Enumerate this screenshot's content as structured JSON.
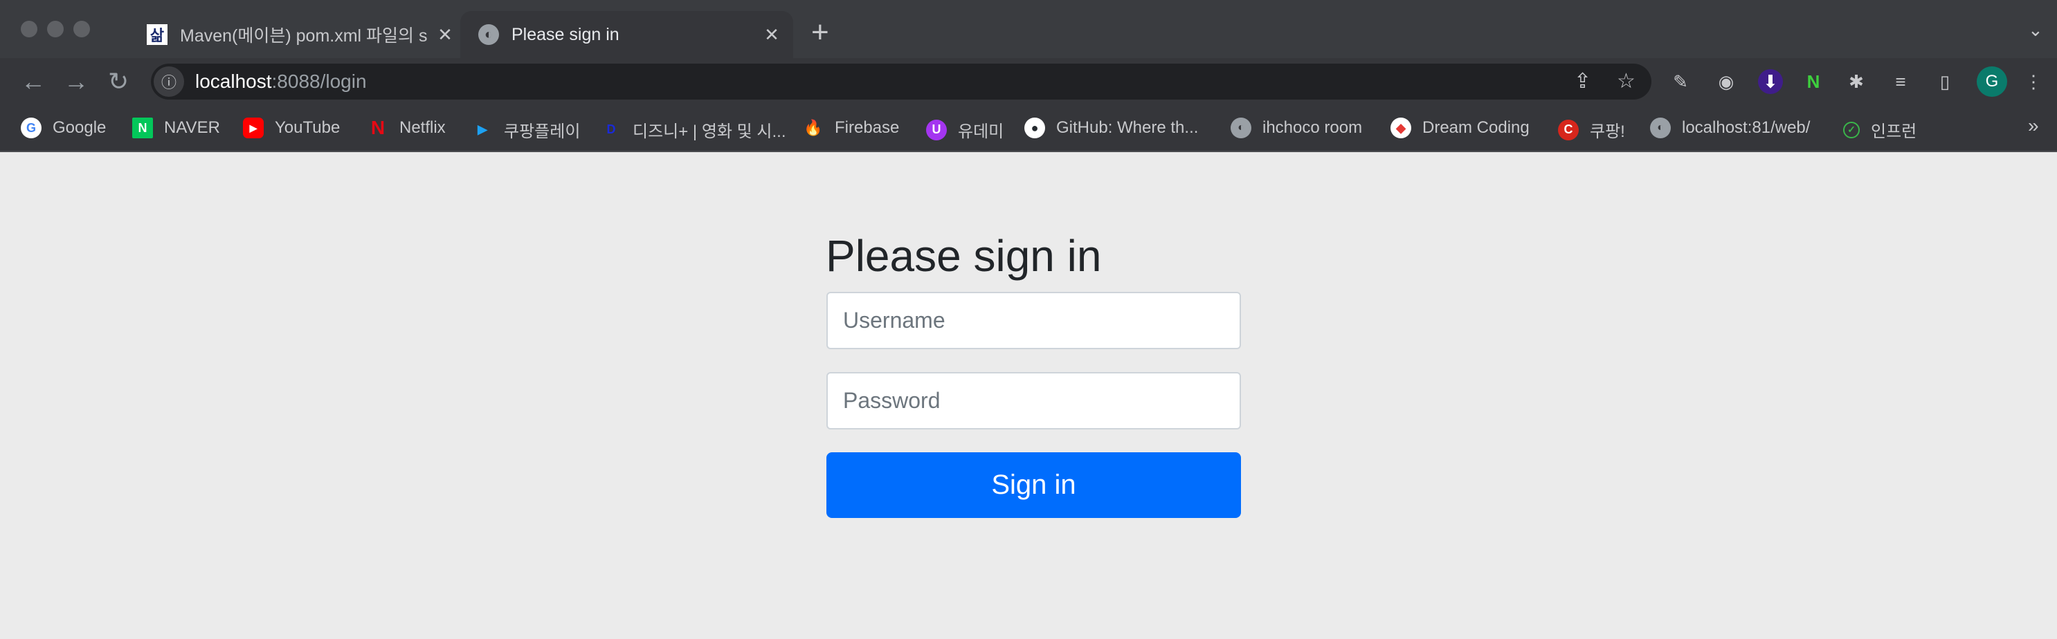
{
  "browser": {
    "tabs": [
      {
        "title": "Maven(메이븐) pom.xml 파일의 s",
        "favicon": "삶",
        "active": false
      },
      {
        "title": "Please sign in",
        "favicon": "globe-icon",
        "active": true
      }
    ],
    "new_tab": "+",
    "tab_search": "⌄",
    "url_host": "localhost",
    "url_rest": ":8088/login",
    "avatar_letter": "G",
    "bookmarks": [
      {
        "label": "Google",
        "icon": "G",
        "color": "#ffffff"
      },
      {
        "label": "NAVER",
        "icon": "N",
        "color": "#03c75a"
      },
      {
        "label": "YouTube",
        "icon": "▶",
        "color": "#ff0000"
      },
      {
        "label": "Netflix",
        "icon": "N",
        "color": "#e50914"
      },
      {
        "label": "쿠팡플레이",
        "icon": "▶",
        "color": "#1da1f2"
      },
      {
        "label": "디즈니+ | 영화 및 시...",
        "icon": "D",
        "color": "#1a2ad8"
      },
      {
        "label": "Firebase",
        "icon": "🔥",
        "color": "#ffca28"
      },
      {
        "label": "유데미",
        "icon": "U",
        "color": "#a435f0"
      },
      {
        "label": "GitHub: Where th...",
        "icon": "●",
        "color": "#ffffff"
      },
      {
        "label": "ihchoco room",
        "icon": "🌐",
        "color": "#9aa0a6"
      },
      {
        "label": "Dream Coding",
        "icon": "◆",
        "color": "#ffffff"
      },
      {
        "label": "쿠팡!",
        "icon": "C",
        "color": "#d7261c"
      },
      {
        "label": "localhost:81/web/",
        "icon": "🌐",
        "color": "#9aa0a6"
      },
      {
        "label": "인프런",
        "icon": "✓",
        "color": "#35363a"
      }
    ],
    "more_bookmarks": "»"
  },
  "page": {
    "heading": "Please sign in",
    "username_placeholder": "Username",
    "password_placeholder": "Password",
    "submit_label": "Sign in",
    "accent": "#006dfd"
  }
}
